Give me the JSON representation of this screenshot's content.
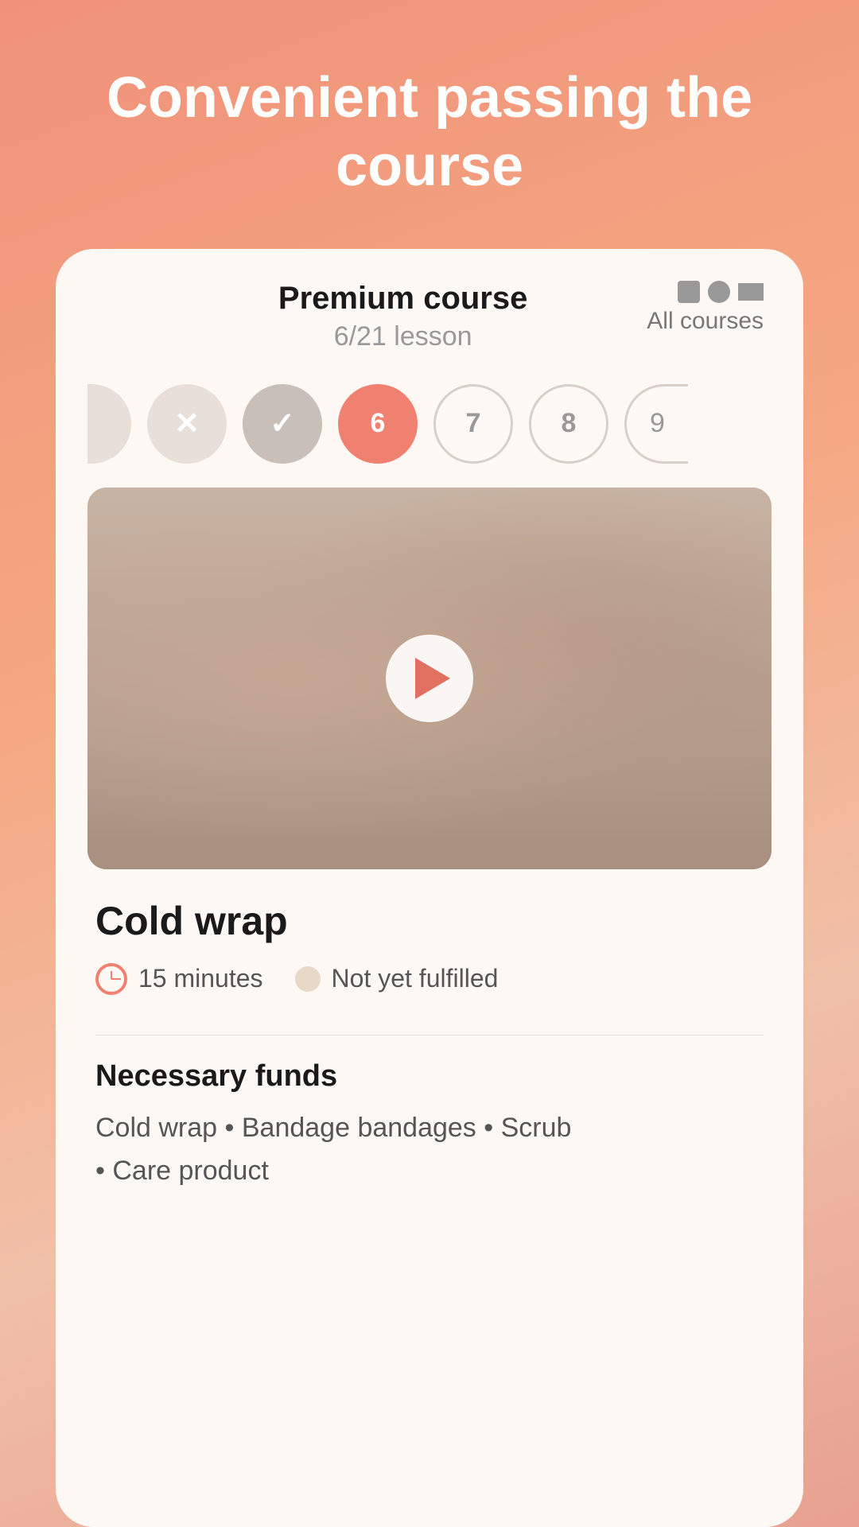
{
  "hero": {
    "title": "Convenient passing the course"
  },
  "card": {
    "course_title": "Premium course",
    "course_lesson": "6/21 lesson",
    "all_courses_label": "All courses",
    "icons": {
      "square": "■",
      "circle": "●",
      "triangle": "▼"
    }
  },
  "lessons": [
    {
      "id": 1,
      "type": "half",
      "label": ""
    },
    {
      "id": 2,
      "type": "fail",
      "label": "✕"
    },
    {
      "id": 3,
      "type": "pass",
      "label": "✓"
    },
    {
      "id": 4,
      "type": "current",
      "label": "6"
    },
    {
      "id": 5,
      "type": "upcoming",
      "label": "7"
    },
    {
      "id": 6,
      "type": "upcoming",
      "label": "8"
    },
    {
      "id": 7,
      "type": "upcoming-half",
      "label": "9"
    }
  ],
  "lesson": {
    "title": "Cold wrap",
    "duration_label": "15 minutes",
    "status_label": "Not yet fulfilled",
    "not_fulfilled_label": "Not fulfilled yet"
  },
  "funds": {
    "title": "Necessary funds",
    "items": "Cold wrap • Bandage bandages • Scrub\n• Care product"
  }
}
